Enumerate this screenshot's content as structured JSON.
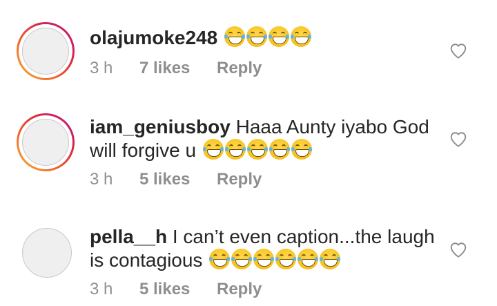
{
  "comments": [
    {
      "username": "olajumoke248",
      "text": "",
      "emoji_count": 4,
      "emoji_icon": "grinning-squinting-face-with-tears",
      "time": "3 h",
      "likes": "7 likes",
      "reply": "Reply",
      "story_ring": true
    },
    {
      "username": "iam_geniusboy",
      "text": "Haaa Aunty iyabo God will forgive u",
      "emoji_count": 5,
      "emoji_icon": "grinning-squinting-face-with-tears",
      "time": "3 h",
      "likes": "5 likes",
      "reply": "Reply",
      "story_ring": true
    },
    {
      "username": "pella__h",
      "text": "I can’t even caption...the laugh is contagious",
      "emoji_count": 6,
      "emoji_icon": "grinning-squinting-face-with-tears",
      "time": "3 h",
      "likes": "5 likes",
      "reply": "Reply",
      "story_ring": false
    }
  ],
  "colors": {
    "text": "#262626",
    "meta": "#8e8e8e",
    "ring_gradient": [
      "#f9b233",
      "#f2662b",
      "#dc2743",
      "#bc1888"
    ]
  },
  "icons": {
    "like": "heart-outline-icon"
  }
}
